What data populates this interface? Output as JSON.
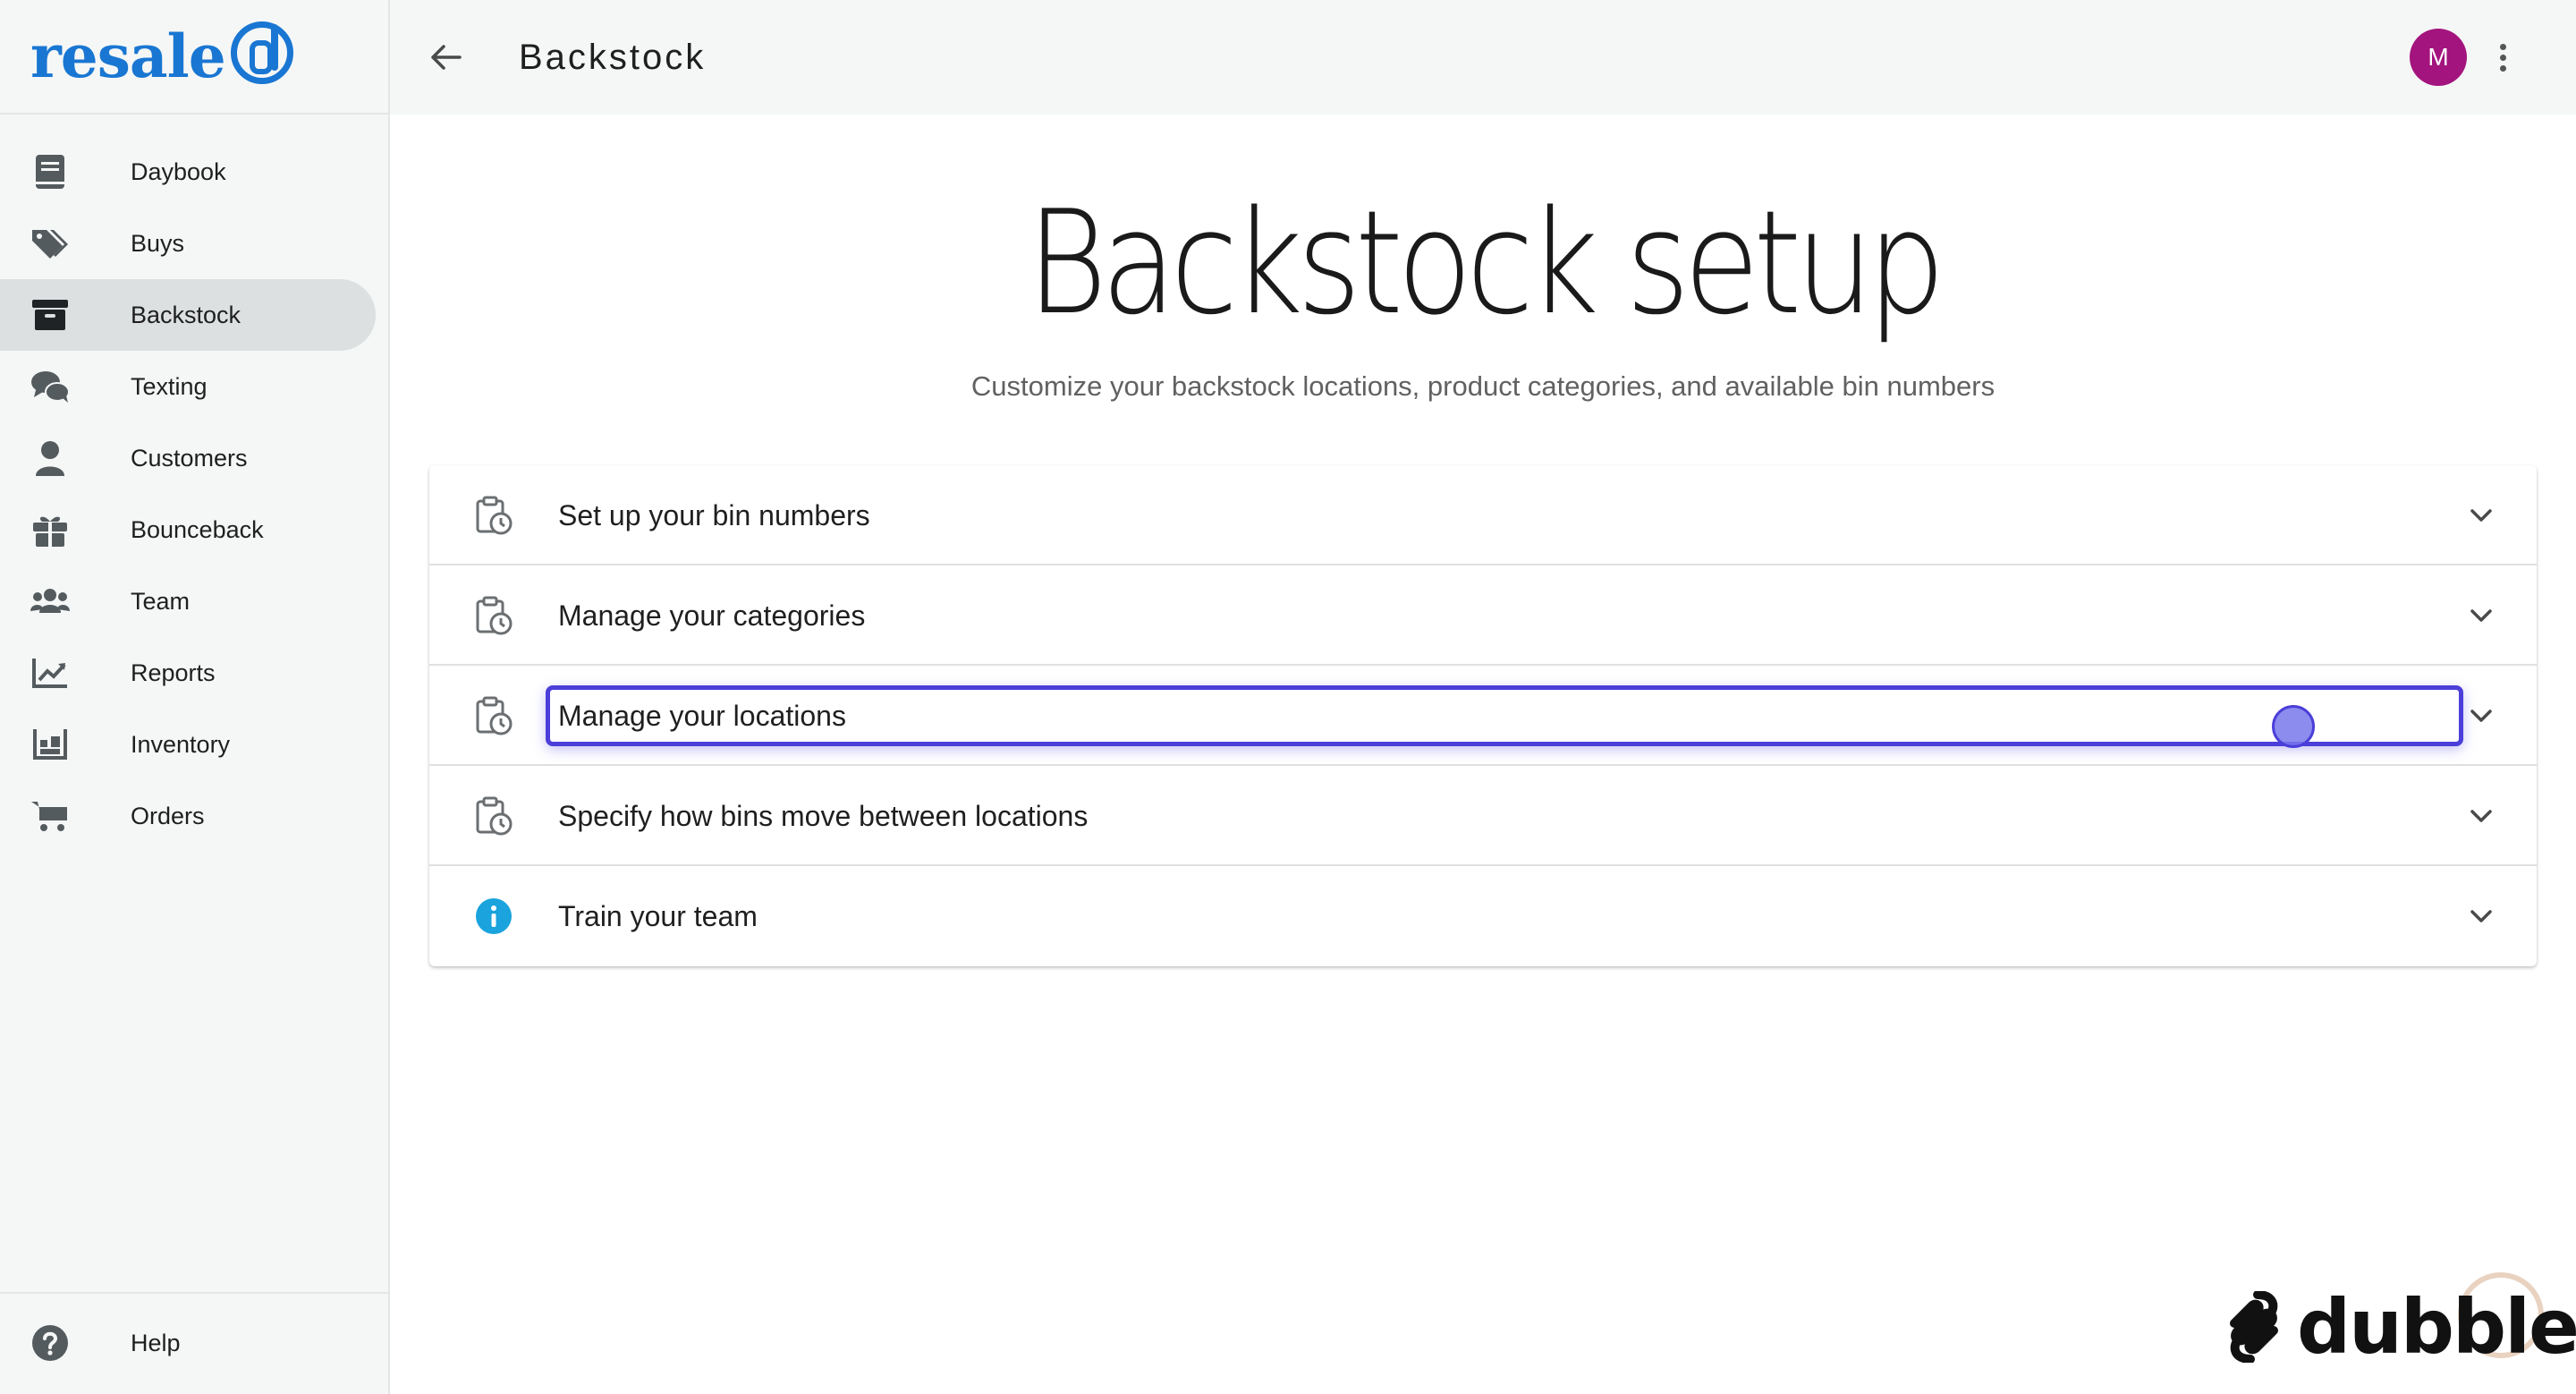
{
  "brand": {
    "logo_text": "resale",
    "logo_color": "#1976d2"
  },
  "sidebar": {
    "items": [
      {
        "label": "Daybook",
        "icon": "book-icon"
      },
      {
        "label": "Buys",
        "icon": "tags-icon"
      },
      {
        "label": "Backstock",
        "icon": "archive-box-icon",
        "active": true
      },
      {
        "label": "Texting",
        "icon": "chat-bubbles-icon"
      },
      {
        "label": "Customers",
        "icon": "person-icon"
      },
      {
        "label": "Bounceback",
        "icon": "gift-icon"
      },
      {
        "label": "Team",
        "icon": "users-icon"
      },
      {
        "label": "Reports",
        "icon": "chart-line-icon"
      },
      {
        "label": "Inventory",
        "icon": "warehouse-icon"
      },
      {
        "label": "Orders",
        "icon": "cart-icon"
      }
    ],
    "help": {
      "label": "Help",
      "icon": "question-circle-icon"
    }
  },
  "header": {
    "title": "Backstock",
    "avatar_initial": "M",
    "avatar_color": "#a3147e"
  },
  "main": {
    "title": "Backstock setup",
    "subtitle": "Customize your backstock locations, product categories, and available bin numbers",
    "sections": [
      {
        "label": "Set up your bin numbers",
        "icon": "clipboard-clock-icon"
      },
      {
        "label": "Manage your categories",
        "icon": "clipboard-clock-icon"
      },
      {
        "label": "Manage your locations",
        "icon": "clipboard-clock-icon",
        "highlighted": true
      },
      {
        "label": "Specify how bins move between locations",
        "icon": "clipboard-clock-icon"
      },
      {
        "label": "Train your team",
        "icon": "info-circle-icon"
      }
    ],
    "highlight_color": "#4b3ed9"
  },
  "watermark": {
    "text": "dubble"
  }
}
